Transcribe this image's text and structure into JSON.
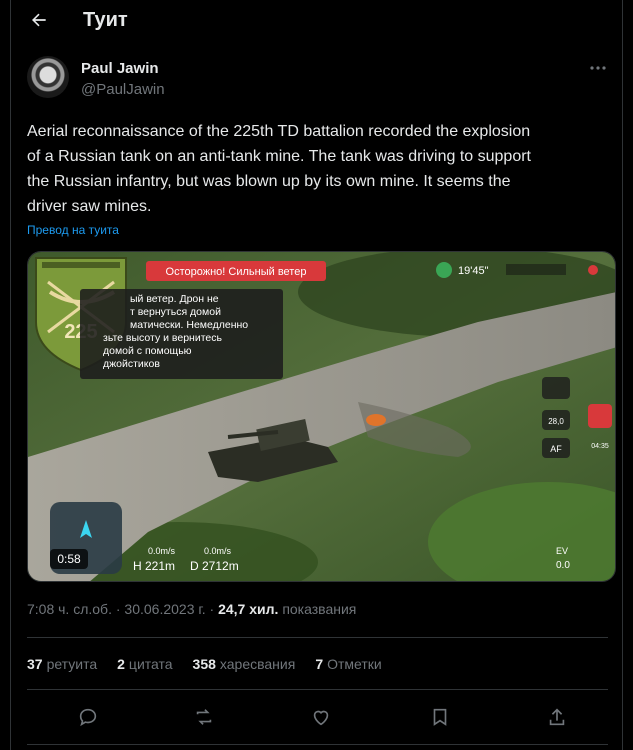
{
  "header": {
    "title": "Туит"
  },
  "author": {
    "name": "Paul Jawin",
    "handle": "@PaulJawin"
  },
  "tweet": {
    "text": "Aerial reconnaissance of the 225th TD battalion recorded the explosion\nof a Russian tank on an anti-tank mine. The tank was driving to support\nthe Russian infantry, but was blown up by its own mine. It seems the\ndriver saw mines.",
    "translate_label": "Превод на туита"
  },
  "media": {
    "duration": "0:58",
    "overlay": {
      "badge_number": "225",
      "warning": "Осторожно! Сильный ветер",
      "message_lines": [
        "ый ветер. Дрон не",
        "т вернуться домой",
        "матически. Немедленно",
        "зьте высоту и вернитесь",
        "домой с помощью",
        "джойстиков"
      ],
      "time": "19'45\"",
      "side_readout": "28,0",
      "af": "AF",
      "rec_time": "04:35",
      "h_label": "H 221m",
      "d_label": "D 2712m",
      "speed_1": "0.0m/s",
      "speed_2": "0.0m/s",
      "ev": "EV",
      "ev_value": "0.0"
    }
  },
  "meta": {
    "timestamp": "7:08 ч. сл.об. · 30.06.2023 г. ·",
    "views_count": "24,7 хил.",
    "views_label": "показвания"
  },
  "stats": [
    {
      "count": "37",
      "label": "ретуита"
    },
    {
      "count": "2",
      "label": "цитата"
    },
    {
      "count": "358",
      "label": "харесвания"
    },
    {
      "count": "7",
      "label": "Отметки"
    }
  ],
  "colors": {
    "background": "#000000",
    "text": "#e7e9ea",
    "muted": "#71767b",
    "link": "#1d9bf0",
    "divider": "#2f3336"
  },
  "icons": [
    "back-arrow-icon",
    "more-icon",
    "reply-icon",
    "retweet-icon",
    "like-icon",
    "bookmark-icon",
    "share-icon"
  ]
}
